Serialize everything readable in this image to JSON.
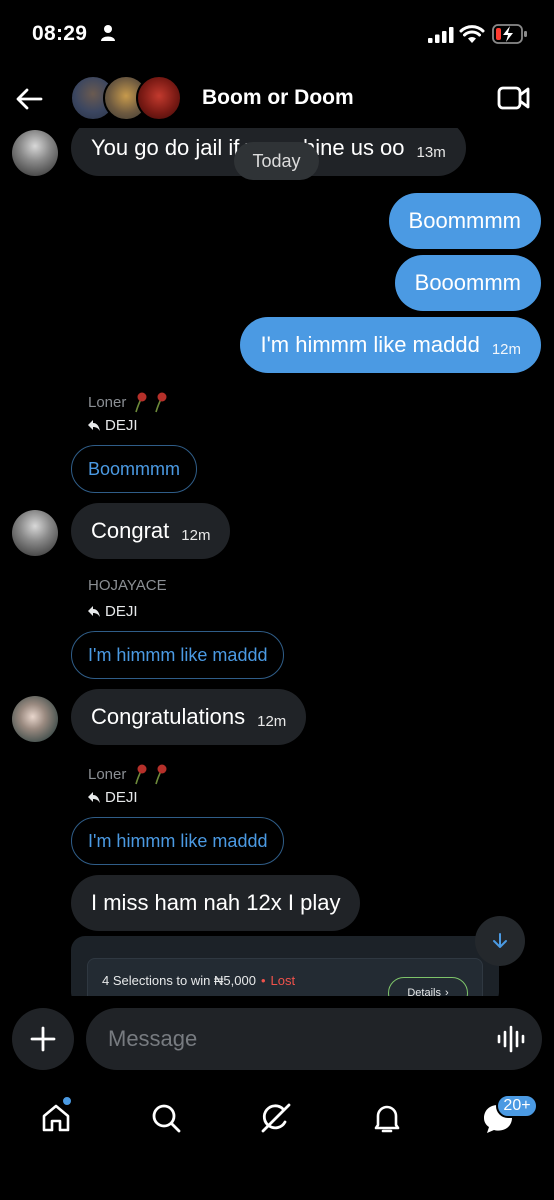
{
  "status_bar": {
    "time": "08:29"
  },
  "header": {
    "title": "Boom or Doom"
  },
  "messages": {
    "today_label": "Today",
    "first_incoming": {
      "text": "You go do jail if you whine us oo",
      "time": "13m"
    },
    "outgoing": [
      {
        "text": "Boommmm",
        "time": ""
      },
      {
        "text": "Booommm",
        "time": ""
      },
      {
        "text": "I'm himmm like maddd",
        "time": "12m"
      }
    ],
    "reply_1": {
      "sender": "Loner",
      "target": "DEJI",
      "quoted": "Boommmm",
      "text": "Congrat",
      "time": "12m"
    },
    "reply_2": {
      "sender": "HOJAYACE",
      "target": "DEJI",
      "quoted": "I'm himmm like maddd",
      "text": "Congratulations",
      "time": "12m"
    },
    "reply_3": {
      "sender": "Loner",
      "target": "DEJI",
      "quoted": "I'm himmm like maddd",
      "text": "I miss ham nah 12x I play"
    },
    "bet_card": {
      "summary": "4 Selections to win ₦5,000",
      "status": "Lost",
      "details_label": "Details"
    }
  },
  "composer": {
    "placeholder": "Message"
  },
  "bottom_nav": {
    "messages_badge": "20+"
  },
  "colors": {
    "accent": "#4b9ae3",
    "incoming_bubble": "#202327",
    "lost": "#f0524b"
  }
}
